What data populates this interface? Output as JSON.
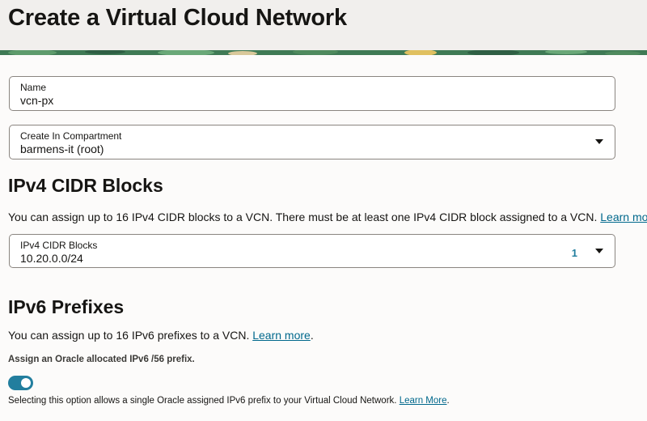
{
  "page": {
    "title": "Create a Virtual Cloud Network"
  },
  "name_field": {
    "label": "Name",
    "value": "vcn-px"
  },
  "compartment_field": {
    "label": "Create In Compartment",
    "value": "barmens-it (root)"
  },
  "ipv4": {
    "heading": "IPv4 CIDR Blocks",
    "description": "You can assign up to 16 IPv4 CIDR blocks to a VCN. There must be at least one IPv4 CIDR block assigned to a VCN.",
    "learn_more": "Learn more",
    "field_label": "IPv4 CIDR Blocks",
    "field_value": "10.20.0.0/24",
    "count": "1"
  },
  "ipv6": {
    "heading": "IPv6 Prefixes",
    "description": "You can assign up to 16 IPv6 prefixes to a VCN.",
    "learn_more": "Learn more",
    "toggle_label": "Assign an Oracle allocated IPv6 /56 prefix.",
    "toggle_on": true,
    "help_text": "Selecting this option allows a single Oracle assigned IPv6 prefix to your Virtual Cloud Network.",
    "help_link": "Learn More"
  },
  "colors": {
    "accent": "#227e9e",
    "link": "#00688c",
    "banner": "#3f7a55"
  }
}
